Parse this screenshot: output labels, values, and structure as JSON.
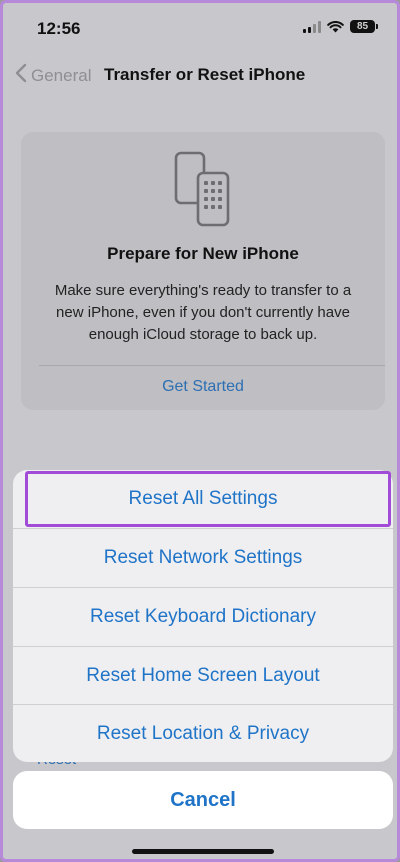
{
  "status_bar": {
    "time": "12:56",
    "battery": "85"
  },
  "nav": {
    "back_label": "General",
    "title": "Transfer or Reset iPhone"
  },
  "card": {
    "icon": "two-phones-icon",
    "title": "Prepare for New iPhone",
    "description": "Make sure everything's ready to transfer to a new iPhone, even if you don't currently have enough iCloud storage to back up.",
    "action_label": "Get Started"
  },
  "background_reset_label": "Reset",
  "action_sheet": {
    "items": [
      {
        "label": "Reset All Settings",
        "highlighted": true
      },
      {
        "label": "Reset Network Settings"
      },
      {
        "label": "Reset Keyboard Dictionary"
      },
      {
        "label": "Reset Home Screen Layout"
      },
      {
        "label": "Reset Location & Privacy"
      }
    ],
    "cancel_label": "Cancel"
  },
  "colors": {
    "accent": "#1f74c8",
    "highlight": "#a24bd6"
  }
}
